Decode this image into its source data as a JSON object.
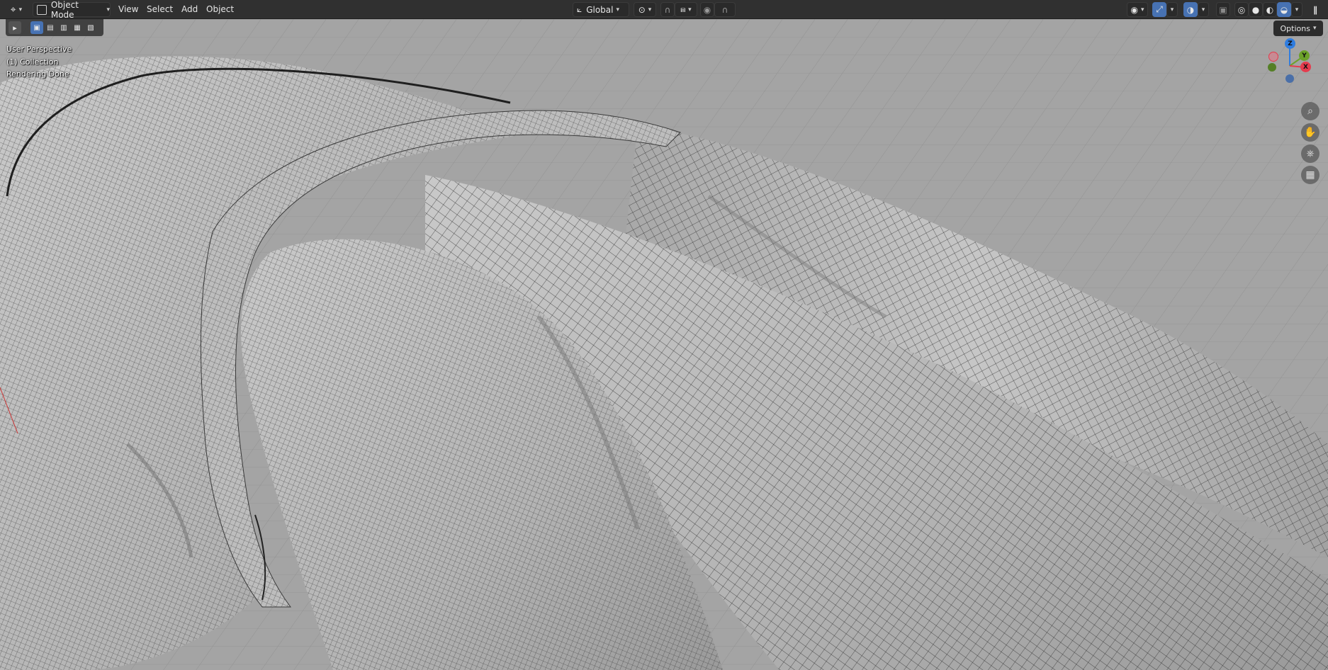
{
  "header": {
    "editor_type_icon": "viewport-editor-icon",
    "mode": "Object Mode",
    "menus": [
      "View",
      "Select",
      "Add",
      "Object"
    ],
    "transform_orientation": "Global"
  },
  "viewport": {
    "view_name": "User Perspective",
    "collection": "(1) Collection",
    "status": "Rendering Done",
    "options_label": "Options",
    "gizmo": {
      "z": "Z",
      "y": "Y",
      "x": "X",
      "colors": {
        "z": "#2f7de0",
        "y": "#6ca12a",
        "x": "#e53c4e"
      }
    }
  },
  "colors": {
    "header_bg": "#303030",
    "active_blue": "#4772b3",
    "viewport_bg": "#9d9d9d",
    "wire": "#2b2b2b"
  }
}
